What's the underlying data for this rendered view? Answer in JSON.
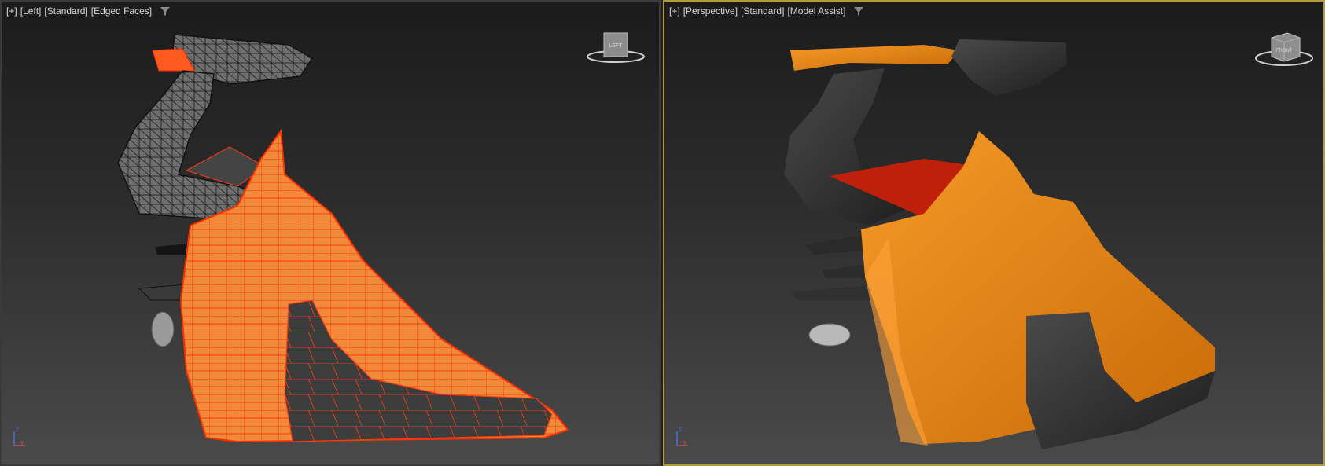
{
  "viewports": [
    {
      "name": "left",
      "labels": [
        "[+]",
        "[Left]",
        "[Standard]",
        "[Edged Faces]"
      ],
      "viewcube_label": "LEFT",
      "active": false
    },
    {
      "name": "perspective",
      "labels": [
        "[+]",
        "[Perspective]",
        "[Standard]",
        "[Model Assist]"
      ],
      "viewcube_label": "FRONT",
      "active": true
    }
  ],
  "colors": {
    "accent_active_border": "#b39a3c",
    "object_orange": "#e07a10",
    "wire_orange": "#ff4a10",
    "object_dark": "#333333"
  },
  "icons": {
    "filter": "funnel-filter-icon",
    "axis": "axis-tripod-icon"
  }
}
